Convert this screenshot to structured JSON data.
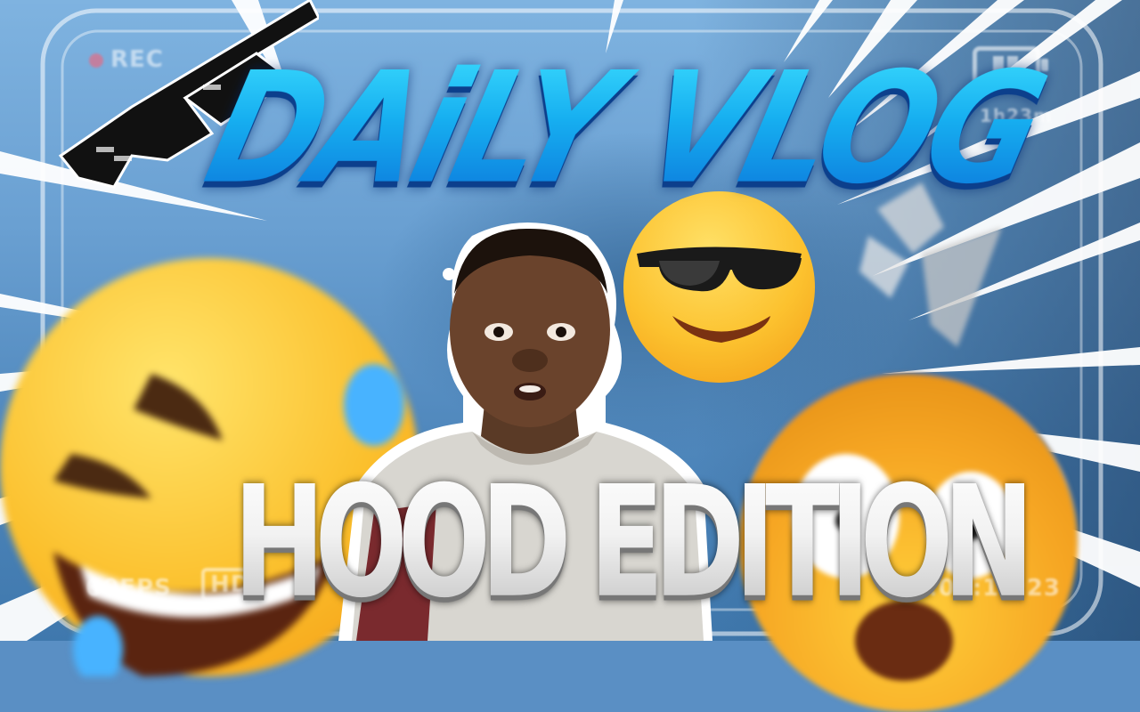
{
  "thumbnail": {
    "title_top": "DAiLY VLOG",
    "title_bottom": "HOOD EDITION"
  },
  "hud": {
    "rec_label": "REC",
    "recording_time": "1h23m",
    "fps_label": "60FPS",
    "quality_label": "HD",
    "timecode": "00:00:14:23",
    "battery_icon": "battery-icon"
  },
  "decorations": {
    "icons": [
      "pixel-sunglasses-icon",
      "laughing-emoji-icon",
      "cool-sunglasses-emoji-icon",
      "shocked-emoji-icon",
      "youtube-logo-icon"
    ],
    "colors": {
      "title_top_gradient": [
        "#3ee0ff",
        "#0a6fd8"
      ],
      "title_bottom_gradient": [
        "#ffffff",
        "#bdbdbd"
      ],
      "rec_dot": "#ff5a6e",
      "background": "#5a8fc4"
    }
  }
}
